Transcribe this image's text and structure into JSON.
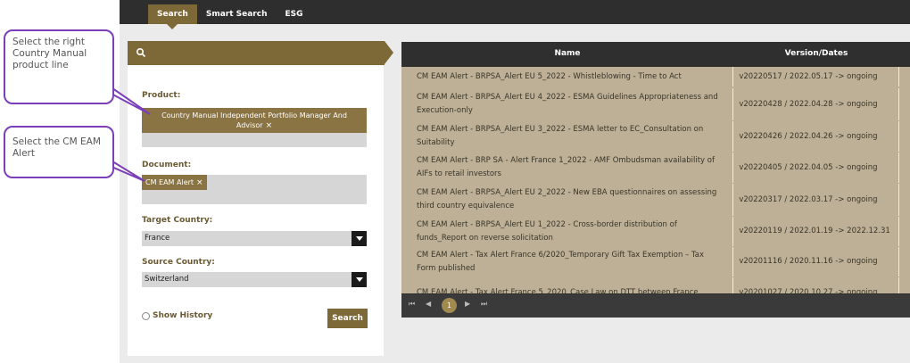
{
  "nav": {
    "tabs": [
      {
        "label": "Search",
        "active": true
      },
      {
        "label": "Smart Search",
        "active": false
      },
      {
        "label": "ESG",
        "active": false
      }
    ]
  },
  "filters": {
    "search_icon": "search-icon",
    "product_label": "Product:",
    "product_tag": "Country Manual Independent Portfolio Manager And Advisor",
    "document_label": "Document:",
    "document_tag": "CM EAM Alert",
    "target_country_label": "Target Country:",
    "target_country_value": "France",
    "source_country_label": "Source Country:",
    "source_country_value": "Switzerland",
    "show_history_label": "Show History",
    "search_button": "Search",
    "remove_glyph": "×"
  },
  "results": {
    "columns": {
      "name": "Name",
      "version": "Version/Dates"
    },
    "rows": [
      {
        "name": "CM EAM Alert - BRPSA_Alert EU 5_2022 - Whistleblowing - Time to Act",
        "version": "v20220517 / 2022.05.17 -> ongoing"
      },
      {
        "name": "CM EAM Alert - BRPSA_Alert EU 4_2022 - ESMA Guidelines Appropriateness and Execution-only",
        "version": "v20220428 / 2022.04.28 -> ongoing"
      },
      {
        "name": "CM EAM Alert - BRPSA_Alert EU 3_2022 - ESMA letter to EC_Consultation on Suitability",
        "version": "v20220426 / 2022.04.26 -> ongoing"
      },
      {
        "name": "CM EAM Alert - BRP SA - Alert France 1_2022 - AMF Ombudsman availability of AIFs to retail investors",
        "version": "v20220405 / 2022.04.05 -> ongoing"
      },
      {
        "name": "CM EAM Alert - BRPSA_Alert EU 2_2022 - New EBA questionnaires on assessing third country equivalence",
        "version": "v20220317 / 2022.03.17 -> ongoing"
      },
      {
        "name": "CM EAM Alert - BRPSA_Alert EU 1_2022 - Cross-border distribution of funds_Report on reverse solicitation",
        "version": "v20220119 / 2022.01.19 -> 2022.12.31"
      },
      {
        "name": "CM EAM Alert - Tax Alert France 6/2020_Temporary Gift Tax Exemption – Tax Form published",
        "version": "v20201116 / 2020.11.16 -> ongoing"
      },
      {
        "name": "CM EAM Alert - Tax Alert France 5_2020_Case Law on DTT between France",
        "version": "v20201027 / 2020.10.27 -> ongoing"
      }
    ],
    "pager": {
      "first": "⏮",
      "prev": "◀",
      "current": "1",
      "next": "▶",
      "last": "⏭"
    }
  },
  "callouts": {
    "product_hint": "Select the right Country Manual product line",
    "document_hint": "Select the CM EAM Alert"
  },
  "colors": {
    "accent": "#7d6838",
    "callout_border": "#7b3fb8",
    "row_bg": "#bdb097"
  }
}
